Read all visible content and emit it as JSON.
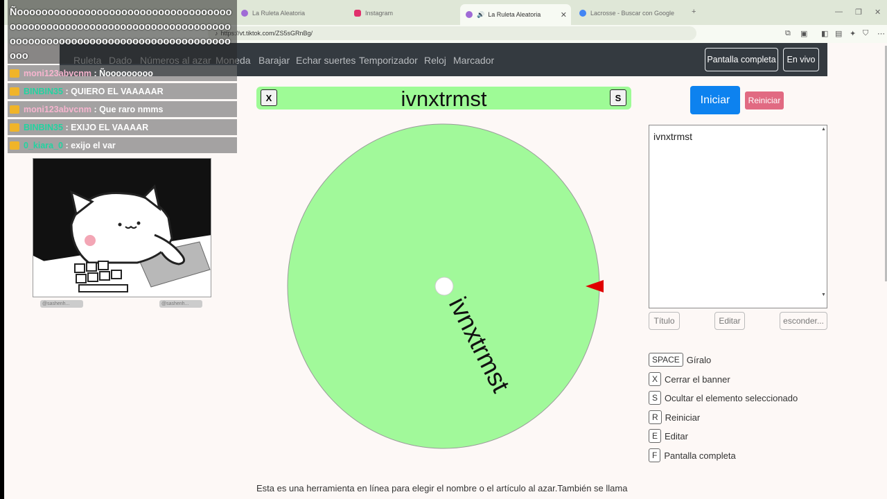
{
  "browser": {
    "tabs": [
      {
        "label": "La Ruleta Aleatoria"
      },
      {
        "label": "Instagram"
      },
      {
        "label": "La Ruleta Aleatoria"
      },
      {
        "label": "Lacrosse - Buscar con Google"
      }
    ],
    "url": "https://vt.tiktok.com/ZS5sGRnBg/",
    "new_tab_glyph": "+"
  },
  "nav": {
    "items": [
      "Ruleta",
      "Dado",
      "Números al azar",
      "Moneda",
      "Barajar",
      "Echar suertes",
      "Temporizador",
      "Reloj",
      "Marcador"
    ],
    "fullscreen": "Pantalla completa",
    "live": "En vivo"
  },
  "banner": {
    "title": "ivnxtrmst",
    "close_key": "X",
    "hide_key": "S"
  },
  "wheel": {
    "segment_label": "ivnxtrmst",
    "color": "#a1f99a",
    "pointer_color": "#e00000"
  },
  "panel": {
    "start": "Iniciar",
    "reset": "Reiniciar",
    "entries": "ivnxtrmst",
    "title_btn": "Título",
    "edit_btn": "Editar",
    "hide_btn": "esconder..."
  },
  "shortcuts": [
    {
      "key": "SPACE",
      "label": "Gíralo"
    },
    {
      "key": "X",
      "label": "Cerrar el banner"
    },
    {
      "key": "S",
      "label": "Ocultar el elemento seleccionado"
    },
    {
      "key": "R",
      "label": "Reiniciar"
    },
    {
      "key": "E",
      "label": "Editar"
    },
    {
      "key": "F",
      "label": "Pantalla completa"
    }
  ],
  "description": "Esta es una herramienta en línea para elegir el nombre o el artículo al azar.También se llama",
  "chat": {
    "big_message": "Ñoooooooooooooooooooooooooooooooooooooooooooooooooooooooooooooooooooooooooooooooooooooooooooooooooooooooooooooo",
    "messages": [
      {
        "user": "moni123abvcnm",
        "text": ": Ñooooooooo",
        "color": "pink"
      },
      {
        "user": "BINBIN35",
        "text": ": QUIERO EL VAAAAAR",
        "color": "teal"
      },
      {
        "user": "moni123abvcnm",
        "text": ": Que raro nmms",
        "color": "pink"
      },
      {
        "user": "BINBIN35",
        "text": ": EXIJO EL VAAAAR",
        "color": "teal"
      },
      {
        "user": "0_kiara_0",
        "text": ": exijo el var",
        "color": "teal"
      }
    ],
    "handles": [
      "@sashenh...",
      "@sashenh..."
    ]
  }
}
